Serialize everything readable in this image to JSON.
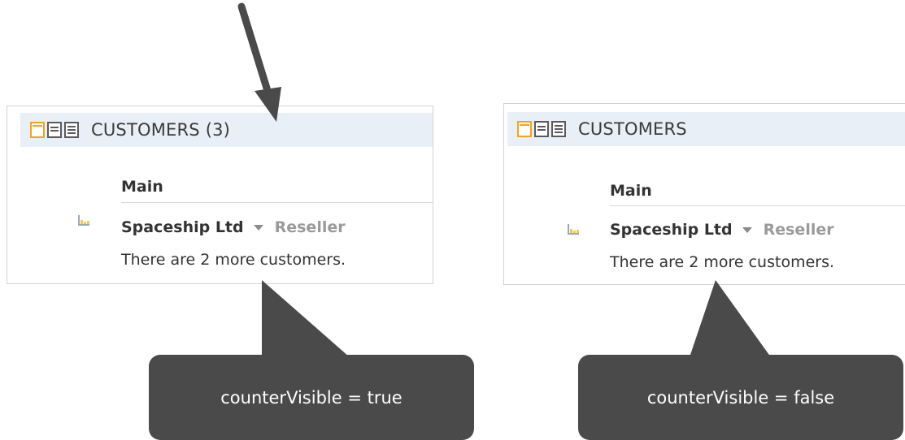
{
  "colors": {
    "header_bg": "#e9eff7",
    "active_view": "#f5a21c",
    "callout_bg": "#4a4a4a",
    "arrow": "#4a4a4a"
  },
  "left_panel": {
    "title": "CUSTOMERS (3)",
    "section": "Main",
    "record_name": "Spaceship Ltd",
    "record_type": "Reseller",
    "more_text": "There are 2 more customers."
  },
  "right_panel": {
    "title": "CUSTOMERS",
    "section": "Main",
    "record_name": "Spaceship Ltd",
    "record_type": "Reseller",
    "more_text": "There are 2 more customers."
  },
  "callouts": {
    "left": "counterVisible = true",
    "right": "counterVisible = false"
  },
  "icons": [
    "view-single-icon",
    "view-details-icon",
    "view-list-icon",
    "customer-record-icon",
    "dropdown-caret-icon"
  ]
}
